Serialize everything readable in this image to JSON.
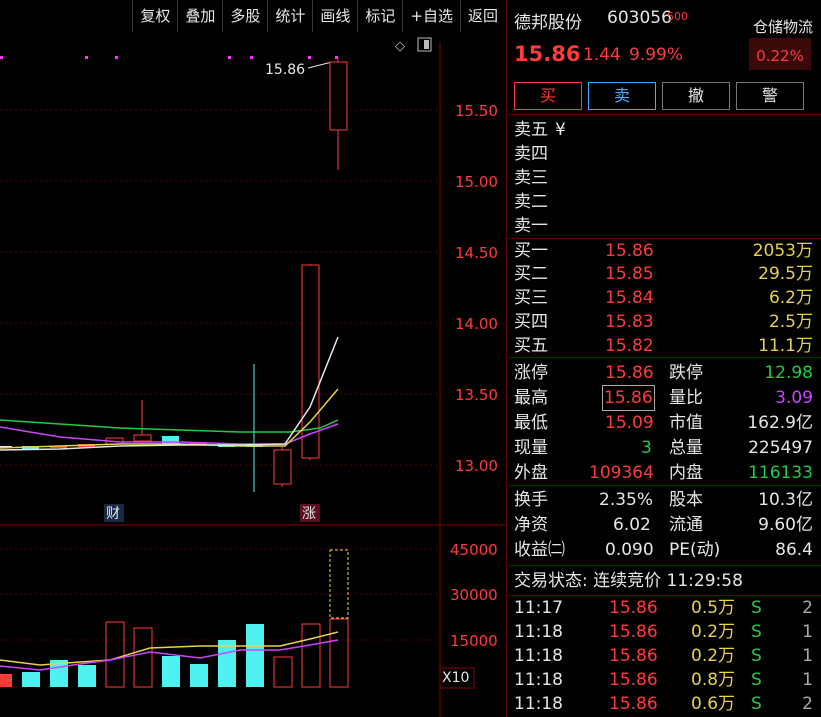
{
  "toolbar": [
    "复权",
    "叠加",
    "多股",
    "统计",
    "画线",
    "标记",
    "+自选",
    "返回"
  ],
  "chart": {
    "price_axis": [
      "15.50",
      "15.00",
      "14.50",
      "14.00",
      "13.50",
      "13.00"
    ],
    "high_label": "15.86",
    "marker_cai": "财",
    "marker_zhang": "涨",
    "vol_axis": [
      "45000",
      "30000",
      "15000"
    ],
    "vol_unit": "X10",
    "colors": {
      "up": "#ff3b3b",
      "down": "#4ff0f0",
      "ma1": "#ffffff",
      "ma2": "#e6d24a",
      "ma3": "#cc44ff",
      "ma4": "#22cc44"
    }
  },
  "quote": {
    "name": "德邦股份",
    "code": "603056",
    "code_sup": "500",
    "sector": "仓储物流",
    "sector_pct": "0.22%",
    "price": "15.86",
    "change": "1.44",
    "change_pct": "9.99%",
    "buttons": {
      "buy": "买",
      "sell": "卖",
      "cancel": "撤",
      "alert": "警"
    }
  },
  "asks": [
    {
      "label": "卖五",
      "extra": "¥"
    },
    {
      "label": "卖四",
      "extra": ""
    },
    {
      "label": "卖三",
      "extra": ""
    },
    {
      "label": "卖二",
      "extra": ""
    },
    {
      "label": "卖一",
      "extra": ""
    }
  ],
  "bids": [
    {
      "label": "买一",
      "price": "15.86",
      "vol": "2053万"
    },
    {
      "label": "买二",
      "price": "15.85",
      "vol": "29.5万"
    },
    {
      "label": "买三",
      "price": "15.84",
      "vol": "6.2万"
    },
    {
      "label": "买四",
      "price": "15.83",
      "vol": "2.5万"
    },
    {
      "label": "买五",
      "price": "15.82",
      "vol": "11.1万"
    }
  ],
  "stats": {
    "zhangting_l": "涨停",
    "zhangting": "15.86",
    "dieting_l": "跌停",
    "dieting": "12.98",
    "zuigao_l": "最高",
    "zuigao": "15.86",
    "liangbi_l": "量比",
    "liangbi": "3.09",
    "zuidi_l": "最低",
    "zuidi": "15.09",
    "shizhi_l": "市值",
    "shizhi": "162.9亿",
    "xianliang_l": "现量",
    "xianliang": "3",
    "zongliang_l": "总量",
    "zongliang": "225497",
    "waipan_l": "外盘",
    "waipan": "109364",
    "neipan_l": "内盘",
    "neipan": "116133",
    "huanshou_l": "换手",
    "huanshou": "2.35%",
    "guben_l": "股本",
    "guben": "10.3亿",
    "jingzi_l": "净资",
    "jingzi": "6.02",
    "liutong_l": "流通",
    "liutong": "9.60亿",
    "shouyi_l": "收益㈡",
    "shouyi": "0.090",
    "pe_l": "PE(动)",
    "pe": "86.4"
  },
  "trade_status": "交易状态: 连续竞价 11:29:58",
  "ticks": [
    {
      "time": "11:17",
      "price": "15.86",
      "vol": "0.5万",
      "side": "S",
      "n": "2"
    },
    {
      "time": "11:18",
      "price": "15.86",
      "vol": "0.2万",
      "side": "S",
      "n": "1"
    },
    {
      "time": "11:18",
      "price": "15.86",
      "vol": "0.2万",
      "side": "S",
      "n": "1"
    },
    {
      "time": "11:18",
      "price": "15.86",
      "vol": "0.8万",
      "side": "S",
      "n": "1"
    },
    {
      "time": "11:18",
      "price": "15.86",
      "vol": "0.6万",
      "side": "S",
      "n": "2"
    }
  ]
}
